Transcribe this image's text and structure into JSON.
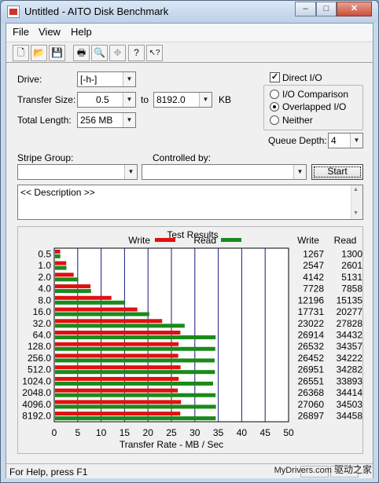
{
  "window": {
    "title": "Untitled - AITO Disk Benchmark",
    "caption_buttons": [
      "–",
      "□",
      "✕"
    ]
  },
  "menu": [
    "File",
    "View",
    "Help"
  ],
  "toolbar": {
    "buttons": [
      {
        "name": "new-icon",
        "glyph": "🗋"
      },
      {
        "name": "open-icon",
        "glyph": "📂"
      },
      {
        "name": "save-icon",
        "glyph": "💾"
      },
      {
        "name": "print-icon",
        "glyph": "🖶"
      },
      {
        "name": "print-preview-icon",
        "glyph": "🔍"
      },
      {
        "name": "move-icon",
        "glyph": "✥"
      },
      {
        "name": "help-icon",
        "glyph": "?"
      },
      {
        "name": "context-help-icon",
        "glyph": "↖?"
      }
    ]
  },
  "settings": {
    "drive_label": "Drive:",
    "drive_value": "[-h-]",
    "transfer_size_label": "Transfer Size:",
    "transfer_from": "0.5",
    "to_label": "to",
    "transfer_to": "8192.0",
    "kb_label": "KB",
    "total_length_label": "Total Length:",
    "total_length_value": "256 MB",
    "direct_io_label": "Direct I/O",
    "direct_io_checked": true,
    "io_options": [
      "I/O Comparison",
      "Overlapped I/O",
      "Neither"
    ],
    "io_selected": 1,
    "queue_depth_label": "Queue Depth:",
    "queue_depth_value": "4",
    "stripe_group_label": "Stripe Group:",
    "stripe_group_value": "",
    "controlled_by_label": "Controlled by:",
    "controlled_by_value": "",
    "start_label": "Start",
    "description_text": "<< Description >>"
  },
  "chart_data": {
    "type": "bar",
    "title": "Test Results",
    "xlabel": "Transfer Rate - MB / Sec",
    "xlim": [
      0,
      50
    ],
    "x_ticks": [
      "0",
      "5",
      "10",
      "15",
      "20",
      "25",
      "30",
      "35",
      "40",
      "45",
      "50"
    ],
    "categories": [
      "0.5",
      "1.0",
      "2.0",
      "4.0",
      "8.0",
      "16.0",
      "32.0",
      "64.0",
      "128.0",
      "256.0",
      "512.0",
      "1024.0",
      "2048.0",
      "4096.0",
      "8192.0"
    ],
    "series": [
      {
        "name": "Write",
        "color": "#e01010",
        "values": [
          1.267,
          2.547,
          4.142,
          7.728,
          12.196,
          17.731,
          23.022,
          26.914,
          26.532,
          26.452,
          26.951,
          26.551,
          26.368,
          27.06,
          26.897
        ]
      },
      {
        "name": "Read",
        "color": "#1a8a1a",
        "values": [
          1.3,
          2.601,
          5.131,
          7.858,
          15.135,
          20.277,
          27.828,
          34.432,
          34.357,
          34.222,
          34.282,
          33.893,
          34.414,
          34.503,
          34.458
        ]
      }
    ],
    "table_headers": [
      "Write",
      "Read"
    ],
    "write_numbers": [
      "1267",
      "2547",
      "4142",
      "7728",
      "12196",
      "17731",
      "23022",
      "26914",
      "26532",
      "26452",
      "26951",
      "26551",
      "26368",
      "27060",
      "26897"
    ],
    "read_numbers": [
      "1300",
      "2601",
      "5131",
      "7858",
      "15135",
      "20277",
      "27828",
      "34432",
      "34357",
      "34222",
      "34282",
      "33893",
      "34414",
      "34503",
      "34458"
    ]
  },
  "status_bar": {
    "text": "For Help, press F1"
  },
  "watermark": {
    "site": "MyDrivers.com",
    "cn": "驱动之家"
  }
}
